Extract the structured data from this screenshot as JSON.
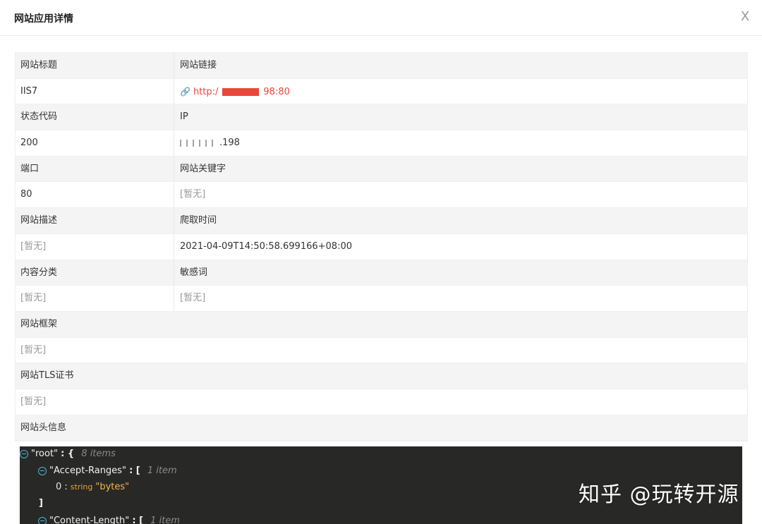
{
  "dialog": {
    "title": "网站应用详情",
    "close_label": "X"
  },
  "fields": {
    "title_label": "网站标题",
    "title_value": "IIS7",
    "link_label": "网站链接",
    "link_prefix": "http:/",
    "link_suffix": "98:80",
    "status_label": "状态代码",
    "status_value": "200",
    "ip_label": "IP",
    "ip_suffix": ".198",
    "port_label": "端口",
    "port_value": "80",
    "keywords_label": "网站关键字",
    "keywords_value": "[暂无]",
    "desc_label": "网站描述",
    "desc_value": "[暂无]",
    "crawl_label": "爬取时间",
    "crawl_value": "2021-04-09T14:50:58.699166+08:00",
    "category_label": "内容分类",
    "category_value": "[暂无]",
    "sensitive_label": "敏感词",
    "sensitive_value": "[暂无]",
    "framework_label": "网站框架",
    "framework_value": "[暂无]",
    "tls_label": "网站TLS证书",
    "tls_value": "[暂无]",
    "headers_label": "网站头信息"
  },
  "json_view": {
    "root_key": "\"root\"",
    "root_open": ": {",
    "root_count": "8 items",
    "accept_key": "\"Accept-Ranges\"",
    "accept_open": ": [",
    "accept_count": "1 item",
    "accept_index": "0 :",
    "accept_type": "string",
    "accept_value": "\"bytes\"",
    "accept_close": "]",
    "content_key": "\"Content-Length\"",
    "content_open": ": [",
    "content_count": "1 item"
  },
  "watermark": "知乎 @玩转开源",
  "colors": {
    "link": "#e8473b",
    "json_bg": "#282826",
    "json_string": "#f5b24a",
    "toggle": "#4fb3d9"
  }
}
